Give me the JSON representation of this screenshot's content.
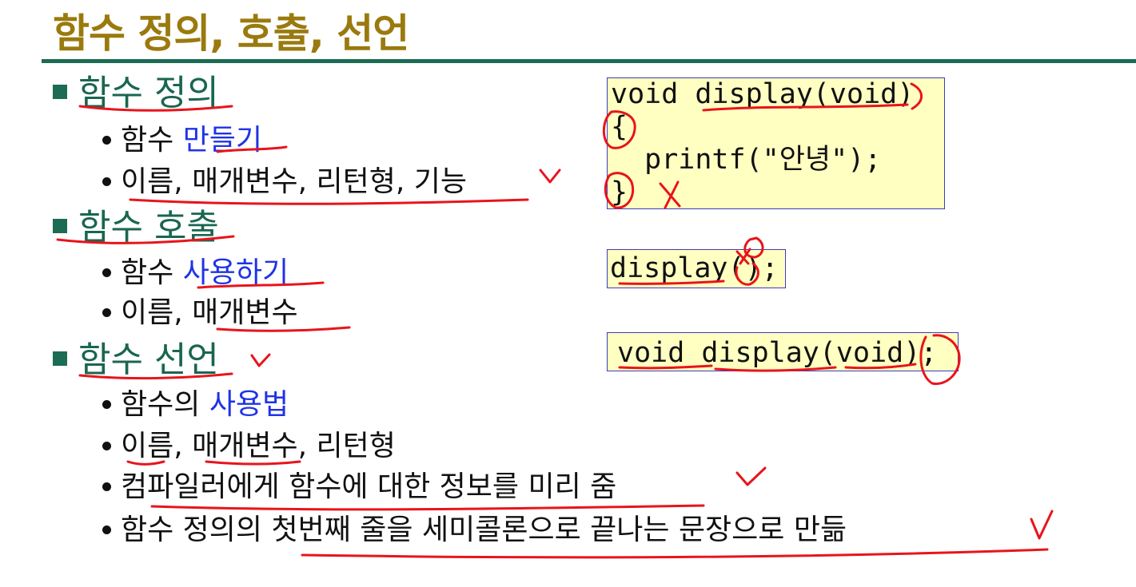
{
  "title": "함수 정의, 호출, 선언",
  "sections": [
    {
      "heading": "함수 정의",
      "items": [
        {
          "prefix": "함수 ",
          "highlight": "만들기",
          "suffix": ""
        },
        {
          "prefix": "이름, 매개변수, 리턴형, 기능",
          "highlight": "",
          "suffix": ""
        }
      ]
    },
    {
      "heading": "함수 호출",
      "items": [
        {
          "prefix": "함수 ",
          "highlight": "사용하기",
          "suffix": ""
        },
        {
          "prefix": "이름, 매개변수",
          "highlight": "",
          "suffix": ""
        }
      ]
    },
    {
      "heading": "함수 선언",
      "items": [
        {
          "prefix": "함수의 ",
          "highlight": "사용법",
          "suffix": ""
        },
        {
          "prefix": "이름, 매개변수, 리턴형",
          "highlight": "",
          "suffix": ""
        },
        {
          "prefix": "컴파일러에게 함수에 대한 정보를 미리 줌",
          "highlight": "",
          "suffix": ""
        },
        {
          "prefix": "함수 정의의 첫번째 줄을 세미콜론으로 끝나는 문장으로 만듦",
          "highlight": "",
          "suffix": ""
        }
      ]
    }
  ],
  "code": {
    "definition": [
      "void display(void)",
      "{",
      "  printf(\"안녕\");",
      "}"
    ],
    "call": "display();",
    "declaration": "void display(void);"
  },
  "colors": {
    "title": "#9a7a0e",
    "heading": "#1a6650",
    "highlight": "#1f33e6",
    "code_background": "#ffffc2",
    "annotation": "#e8141c"
  }
}
